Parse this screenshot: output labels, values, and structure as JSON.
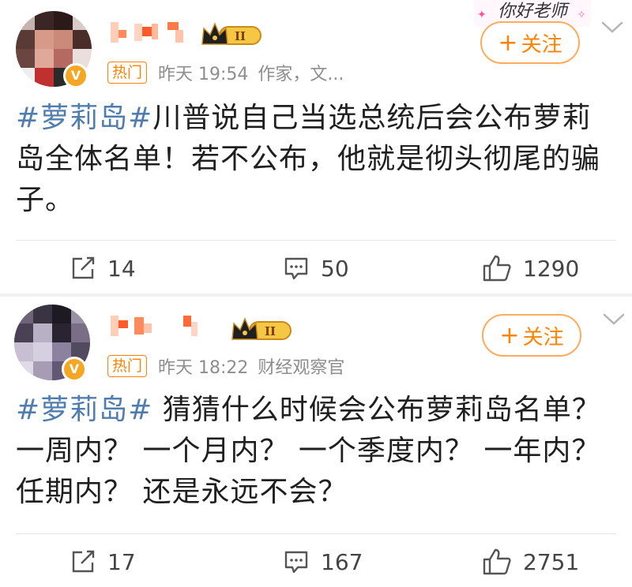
{
  "posts": [
    {
      "hot_label": "热门",
      "time": "昨天 19:54",
      "source": "作家，文...",
      "follow_label": "关注",
      "follow_plus": "+",
      "topic": "#萝莉岛#",
      "text": "川普说自己当选总统后会公布萝莉岛全体名单！若不公布，他就是彻头彻尾的骗子。",
      "reposts": "14",
      "comments": "50",
      "likes": "1290",
      "crown_level": "II",
      "sticker_text": "你好老师"
    },
    {
      "hot_label": "热门",
      "time": "昨天 18:22",
      "source": "财经观察官",
      "follow_label": "关注",
      "follow_plus": "+",
      "topic": "#萝莉岛#",
      "text": " 猜猜什么时候会公布萝莉岛名单？一周内？ 一个月内？ 一个季度内？ 一年内？任期内？ 还是永远不会？",
      "reposts": "17",
      "comments": "167",
      "likes": "2751",
      "crown_level": "II"
    }
  ],
  "icons": {
    "repost": "repost-icon",
    "comment": "comment-icon",
    "like": "like-icon",
    "more": "chevron-down-icon",
    "verified": "verified-badge-icon",
    "crown": "crown-level-icon"
  },
  "colors": {
    "topic": "#507daf",
    "accent": "#ff8200",
    "follow_border": "#ffab5c",
    "meta": "#8e8e8e",
    "verified": "#f5a623"
  }
}
